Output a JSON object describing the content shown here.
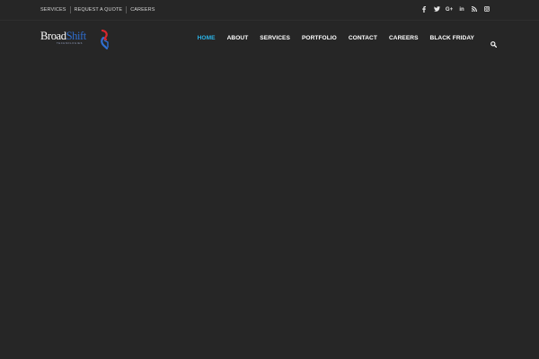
{
  "topbar": {
    "links": [
      "SERVICES",
      "REQUEST A QUOTE",
      "CAREERS"
    ],
    "social_icons": [
      "facebook-icon",
      "twitter-icon",
      "google-plus-icon",
      "linkedin-icon",
      "rss-icon",
      "instagram-icon"
    ],
    "google_plus_label": "G+",
    "linkedin_label": "in"
  },
  "header": {
    "logo": {
      "text_part1": "Broad",
      "text_part2": "Shift",
      "subtitle": "TECHNOLOGIES",
      "colors": {
        "primary": "#ffffff",
        "accent": "#2f6fd2",
        "mark_red": "#d8262c"
      }
    },
    "nav": {
      "items": [
        "HOME",
        "ABOUT",
        "SERVICES",
        "PORTFOLIO",
        "CONTACT",
        "CAREERS",
        "BLACK FRIDAY"
      ],
      "active_index": 0,
      "active_color": "#2ab4e8"
    },
    "search_icon": "search-icon"
  },
  "colors": {
    "background": "#262626",
    "text": "#ffffff"
  }
}
